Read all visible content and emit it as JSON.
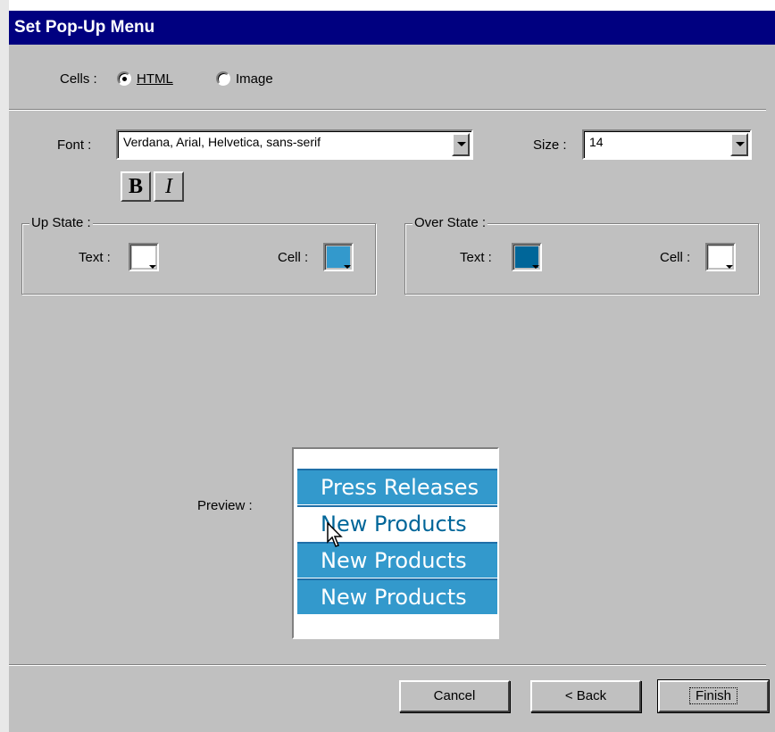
{
  "window": {
    "title": "Set Pop-Up Menu"
  },
  "cells": {
    "label": "Cells :",
    "options": [
      {
        "label": "HTML",
        "selected": true
      },
      {
        "label": "Image",
        "selected": false
      }
    ]
  },
  "font": {
    "label": "Font :",
    "value": "Verdana, Arial, Helvetica, sans-serif",
    "bold_label": "B",
    "italic_label": "I"
  },
  "size": {
    "label": "Size :",
    "value": "14"
  },
  "up_state": {
    "title": "Up State :",
    "text_label": "Text :",
    "text_color": "#ffffff",
    "cell_label": "Cell :",
    "cell_color": "#3399cc"
  },
  "over_state": {
    "title": "Over State :",
    "text_label": "Text :",
    "text_color": "#006699",
    "cell_label": "Cell :",
    "cell_color": "#ffffff"
  },
  "preview": {
    "label": "Preview :",
    "items": [
      {
        "text": "Press Releases",
        "state": "up"
      },
      {
        "text": "New Products",
        "state": "over"
      },
      {
        "text": "New Products",
        "state": "up"
      },
      {
        "text": "New Products",
        "state": "up"
      }
    ]
  },
  "buttons": {
    "cancel": "Cancel",
    "back": "< Back",
    "finish": "Finish"
  }
}
